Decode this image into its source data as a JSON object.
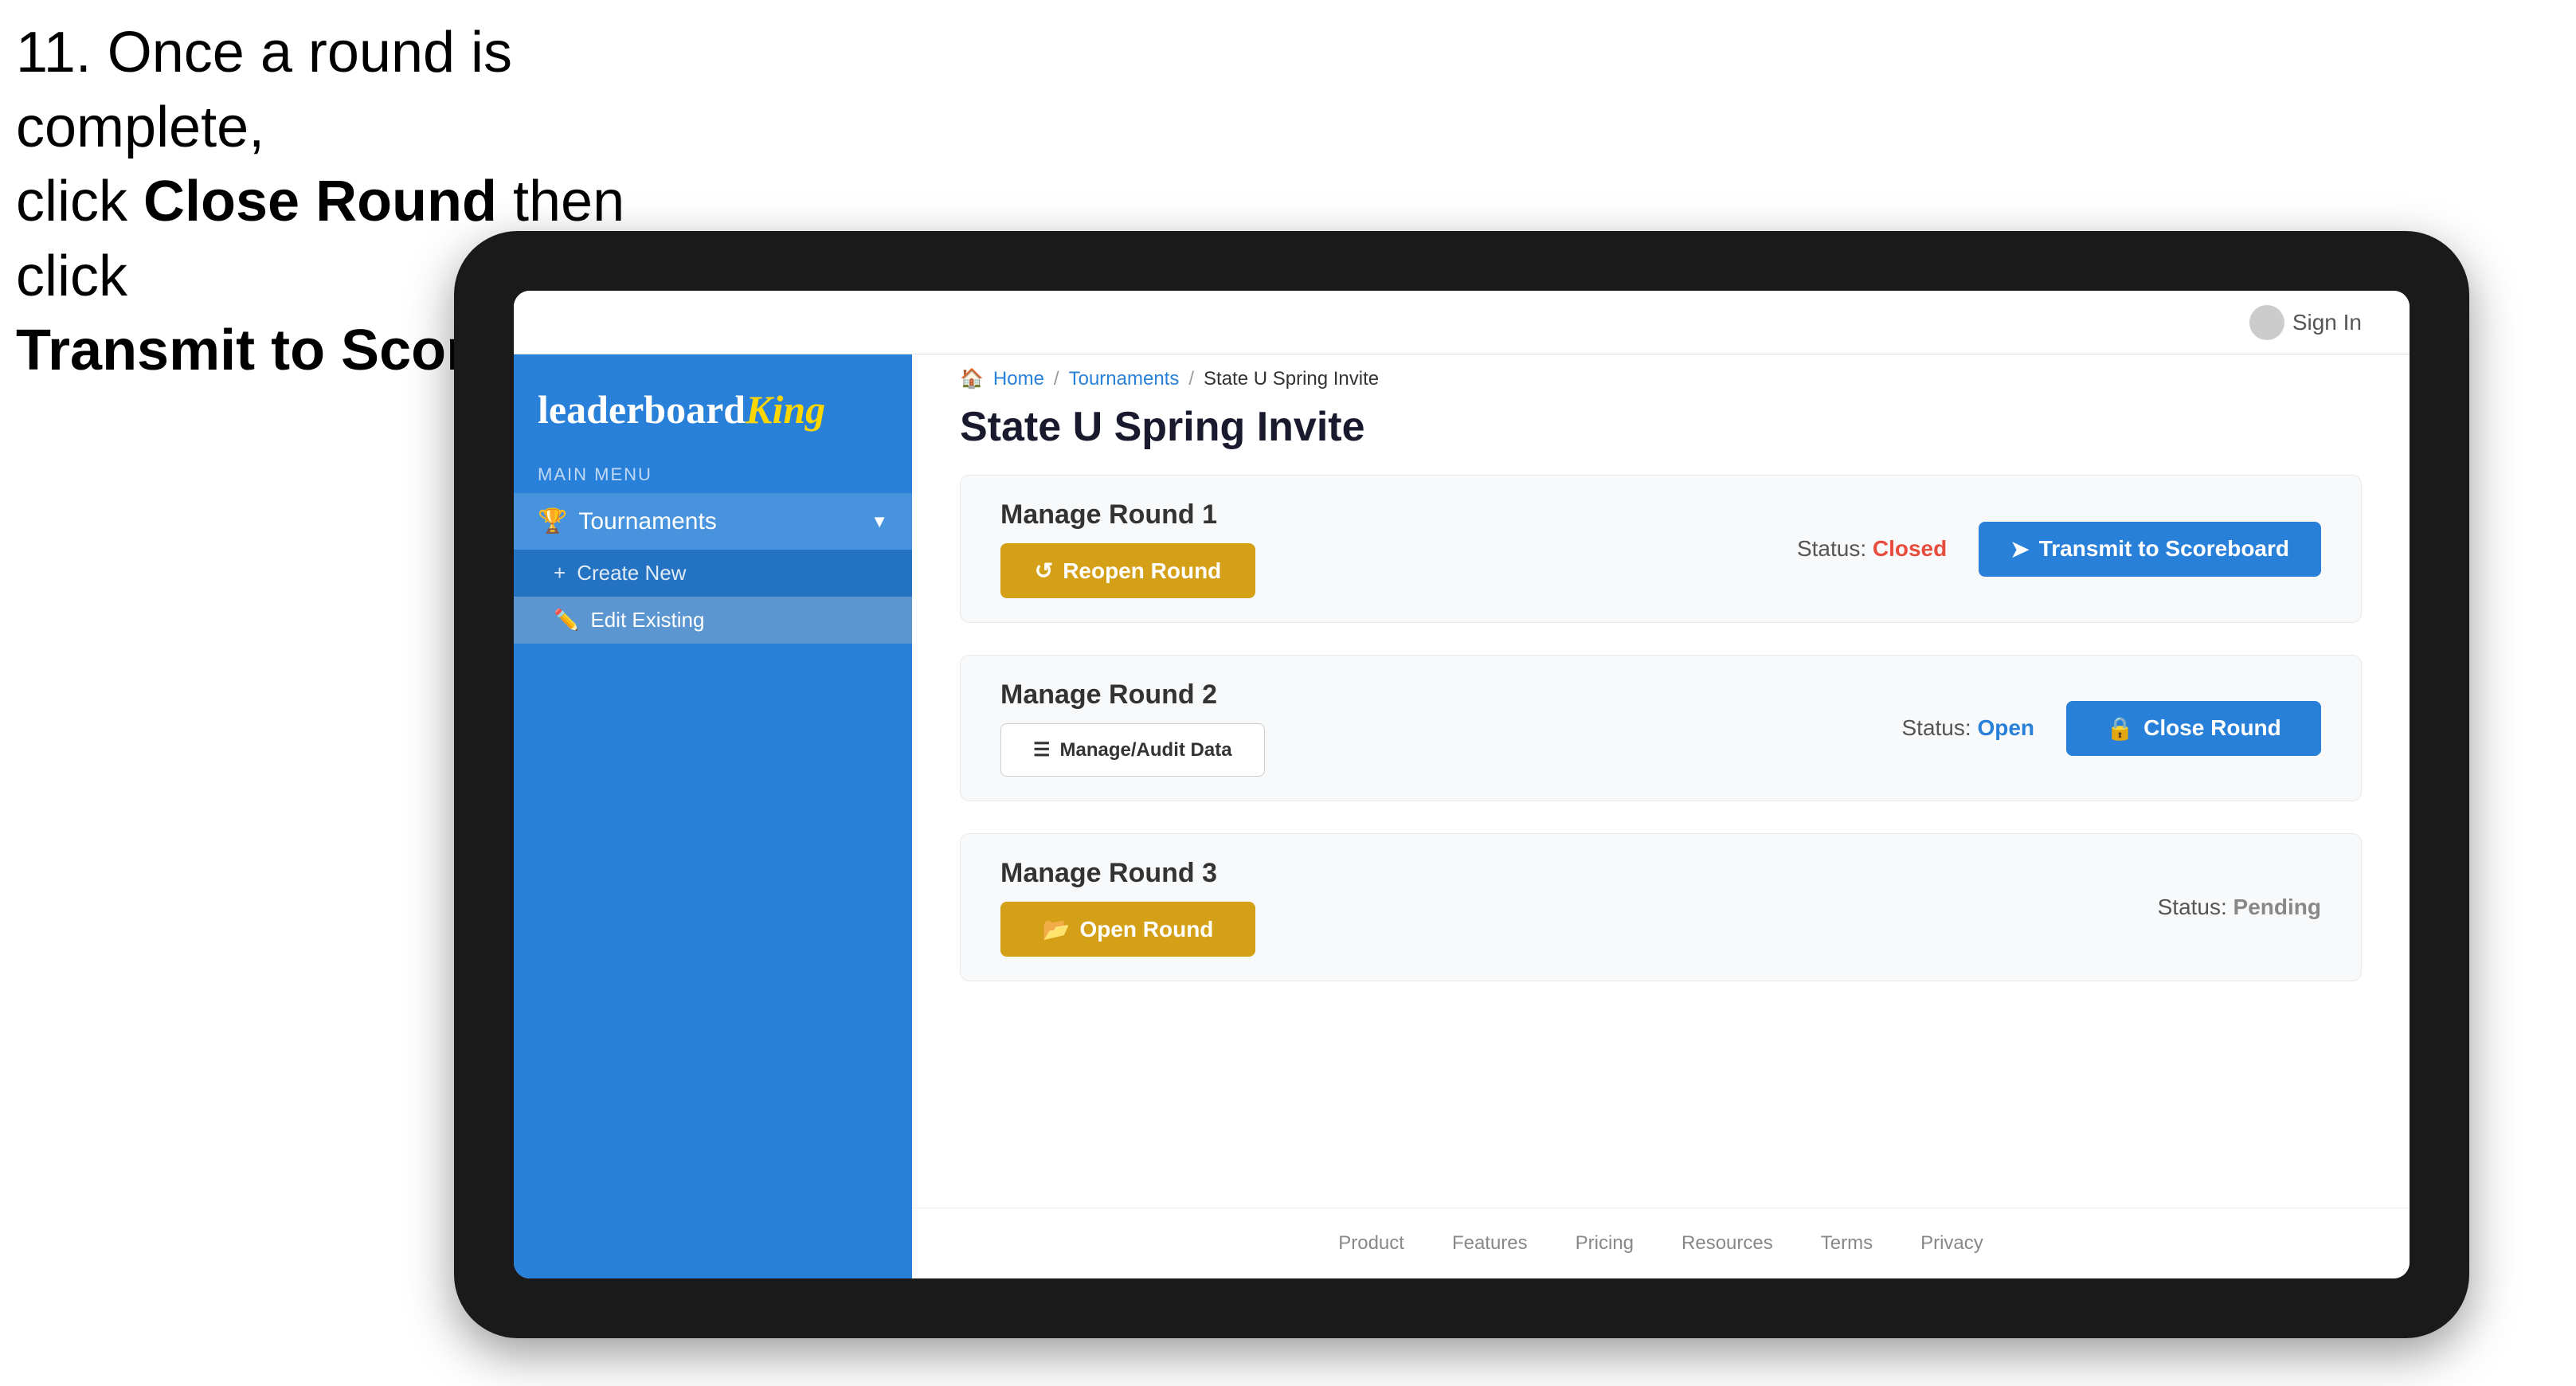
{
  "instruction": {
    "line1": "11. Once a round is complete,",
    "line2_prefix": "click ",
    "line2_bold": "Close Round",
    "line2_suffix": " then click",
    "line3_bold": "Transmit to Scoreboard."
  },
  "header": {
    "sign_in_label": "Sign In"
  },
  "sidebar": {
    "logo_leaderboard": "leaderboard",
    "logo_king": "King",
    "main_menu_label": "MAIN MENU",
    "tournaments_label": "Tournaments",
    "create_new_label": "Create New",
    "edit_existing_label": "Edit Existing"
  },
  "breadcrumb": {
    "home": "Home",
    "tournaments": "Tournaments",
    "current": "State U Spring Invite"
  },
  "page": {
    "title": "State U Spring Invite"
  },
  "rounds": [
    {
      "id": "round1",
      "title": "Manage Round 1",
      "status_label": "Status:",
      "status_value": "Closed",
      "status_type": "closed",
      "primary_btn_label": "Reopen Round",
      "primary_btn_icon": "↺",
      "secondary_btn_label": "Transmit to Scoreboard",
      "secondary_btn_icon": "➤"
    },
    {
      "id": "round2",
      "title": "Manage Round 2",
      "status_label": "Status:",
      "status_value": "Open",
      "status_type": "open",
      "audit_btn_label": "Manage/Audit Data",
      "audit_btn_icon": "☰",
      "primary_btn_label": "Close Round",
      "primary_btn_icon": "🔒"
    },
    {
      "id": "round3",
      "title": "Manage Round 3",
      "status_label": "Status:",
      "status_value": "Pending",
      "status_type": "pending",
      "primary_btn_label": "Open Round",
      "primary_btn_icon": "📂"
    }
  ],
  "footer": {
    "links": [
      "Product",
      "Features",
      "Pricing",
      "Resources",
      "Terms",
      "Privacy"
    ]
  }
}
